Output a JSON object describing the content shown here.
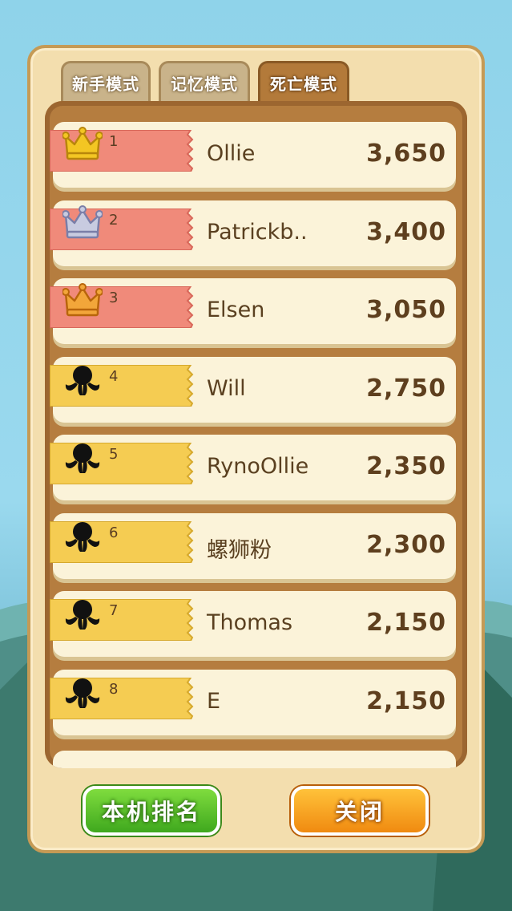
{
  "tabs": [
    {
      "label": "新手模式",
      "active": false
    },
    {
      "label": "记忆模式",
      "active": false
    },
    {
      "label": "死亡模式",
      "active": true
    }
  ],
  "leaderboard": [
    {
      "rank": "1",
      "name": "Ollie",
      "score": "3,650",
      "badge": "gold-crown-icon"
    },
    {
      "rank": "2",
      "name": "Patrickb..",
      "score": "3,400",
      "badge": "silver-crown-icon"
    },
    {
      "rank": "3",
      "name": "Elsen",
      "score": "3,050",
      "badge": "bronze-crown-icon"
    },
    {
      "rank": "4",
      "name": "Will",
      "score": "2,750",
      "badge": "octopus-silhouette-icon"
    },
    {
      "rank": "5",
      "name": "RynoOllie",
      "score": "2,350",
      "badge": "octopus-silhouette-icon"
    },
    {
      "rank": "6",
      "name": "螺狮粉",
      "score": "2,300",
      "badge": "octopus-silhouette-icon"
    },
    {
      "rank": "7",
      "name": "Thomas",
      "score": "2,150",
      "badge": "octopus-silhouette-icon"
    },
    {
      "rank": "8",
      "name": "E",
      "score": "2,150",
      "badge": "octopus-silhouette-icon"
    }
  ],
  "buttons": {
    "local_rank": "本机排名",
    "close": "关闭"
  },
  "colors": {
    "top_ribbon": "#f08a7a",
    "other_ribbon": "#f5cc52",
    "gold": "#f3c623",
    "silver": "#c8cbe0",
    "bronze": "#f2a63a"
  }
}
